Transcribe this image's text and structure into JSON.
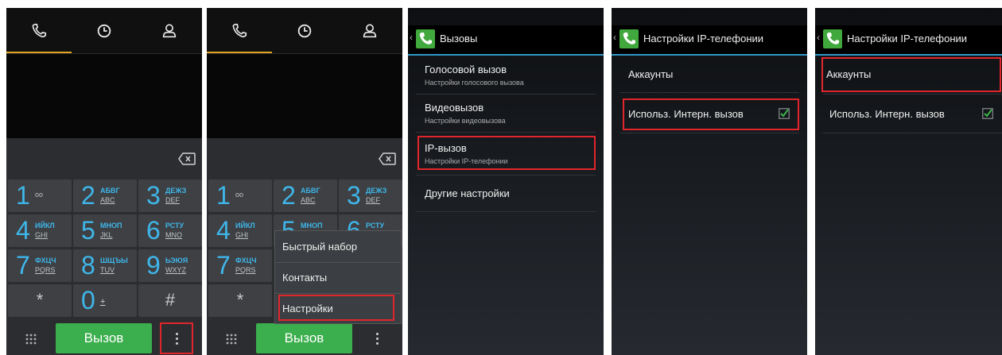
{
  "dialer": {
    "keys": [
      {
        "digit": "1",
        "top": "",
        "bottom": "oo"
      },
      {
        "digit": "2",
        "top": "АБВГ",
        "bottom": "ABC"
      },
      {
        "digit": "3",
        "top": "ДЕЖЗ",
        "bottom": "DEF"
      },
      {
        "digit": "4",
        "top": "ИЙКЛ",
        "bottom": "GHI"
      },
      {
        "digit": "5",
        "top": "МНОП",
        "bottom": "JKL"
      },
      {
        "digit": "6",
        "top": "РСТУ",
        "bottom": "MNO"
      },
      {
        "digit": "7",
        "top": "ФХЦЧ",
        "bottom": "PQRS"
      },
      {
        "digit": "8",
        "top": "ШЩЪЫ",
        "bottom": "TUV"
      },
      {
        "digit": "9",
        "top": "ЬЭЮЯ",
        "bottom": "WXYZ"
      }
    ],
    "star": "*",
    "zero": "0",
    "zero_sub": "+",
    "hash": "#",
    "call_label": "Вызов",
    "icons": {
      "tab1": "phone-icon",
      "tab2": "clock-icon",
      "tab3": "contacts-icon",
      "delete": "backspace-icon",
      "grid": "dialpad-icon",
      "menu": "overflow-menu-icon"
    },
    "accent_color": "#e0a422",
    "key_color": "#3fb6e9",
    "call_color": "#3bae4d"
  },
  "menu": {
    "items": [
      "Быстрый набор",
      "Контакты",
      "Настройки"
    ]
  },
  "calls": {
    "title": "Вызовы",
    "items": [
      {
        "title": "Голосовой вызов",
        "subtitle": "Настройки голосового вызова"
      },
      {
        "title": "Видеовызов",
        "subtitle": "Настройки видеовызова"
      },
      {
        "title": "IP-вызов",
        "subtitle": "Настройки IP-телефонии"
      },
      {
        "title": "Другие настройки",
        "subtitle": ""
      }
    ]
  },
  "ip": {
    "title": "Настройки IP-телефонии",
    "accounts": "Аккаунты",
    "use_internet": "Использ. Интерн. вызов",
    "use_internet_checked": true
  },
  "highlight_color": "#e0262c"
}
